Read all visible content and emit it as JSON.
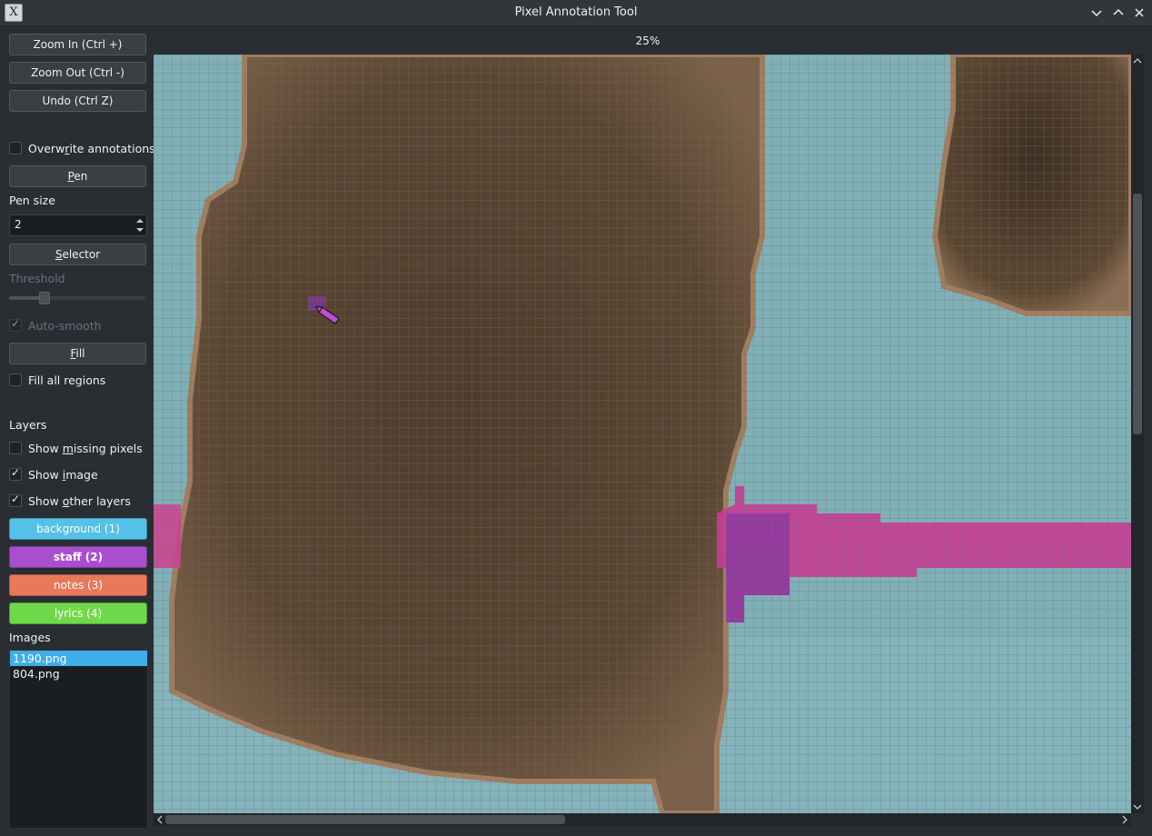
{
  "window": {
    "title": "Pixel Annotation Tool",
    "icon_letter": "X"
  },
  "sidebar": {
    "zoom_in": "Zoom In (Ctrl +)",
    "zoom_out": "Zoom Out (Ctrl -)",
    "undo": "Undo (Ctrl Z)",
    "overwrite_pre": "Overw",
    "overwrite_mn": "r",
    "overwrite_post": "ite annotations",
    "pen_mn": "P",
    "pen_post": "en",
    "pen_size_label": "Pen size",
    "pen_size_value": "2",
    "selector_mn": "S",
    "selector_post": "elector",
    "threshold_label": "Threshold",
    "threshold_level": 0.25,
    "auto_smooth": "Auto-smooth",
    "fill_mn": "F",
    "fill_post": "ill",
    "fill_all": "Fill all regions",
    "layers_heading": "Layers",
    "show_missing_pre": "Show ",
    "show_missing_mn": "m",
    "show_missing_post": "issing pixels",
    "show_image_pre": "Show ",
    "show_image_mn": "i",
    "show_image_post": "mage",
    "show_other_pre": "Show ",
    "show_other_mn": "o",
    "show_other_post": "ther layers",
    "images_heading": "Images"
  },
  "layers": [
    {
      "label": "background (1)",
      "color": "#55c0e8"
    },
    {
      "label": "staff (2)",
      "color": "#a84fd0"
    },
    {
      "label": "notes (3)",
      "color": "#e8785a"
    },
    {
      "label": "lyrics (4)",
      "color": "#6fd94a"
    }
  ],
  "images": [
    "1190.png",
    "804.png"
  ],
  "canvas": {
    "zoom": "25%"
  }
}
